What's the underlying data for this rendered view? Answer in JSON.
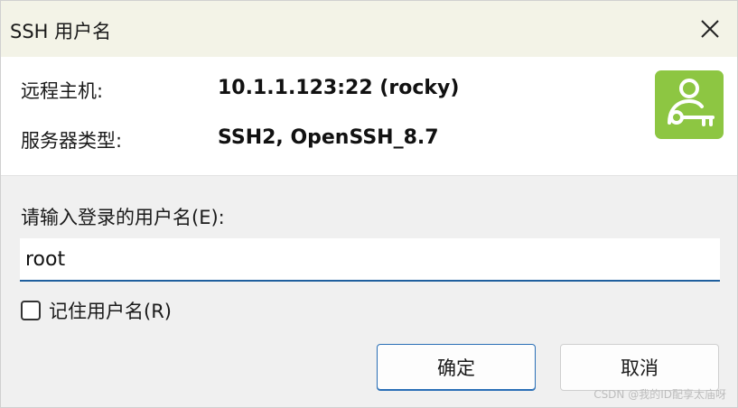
{
  "window": {
    "title": "SSH 用户名",
    "close_icon": "close-icon"
  },
  "info": {
    "host_label": "远程主机:",
    "host_value": "10.1.1.123:22 (rocky)",
    "server_type_label": "服务器类型:",
    "server_type_value": "SSH2, OpenSSH_8.7",
    "icon": "user-key-icon",
    "icon_color": "#8dc642"
  },
  "form": {
    "prompt_label": "请输入登录的用户名(E):",
    "username_value": "root",
    "remember_label": "记住用户名(R)",
    "remember_checked": false
  },
  "buttons": {
    "ok_label": "确定",
    "cancel_label": "取消"
  },
  "watermark": "CSDN @我的ID配享太庙呀"
}
